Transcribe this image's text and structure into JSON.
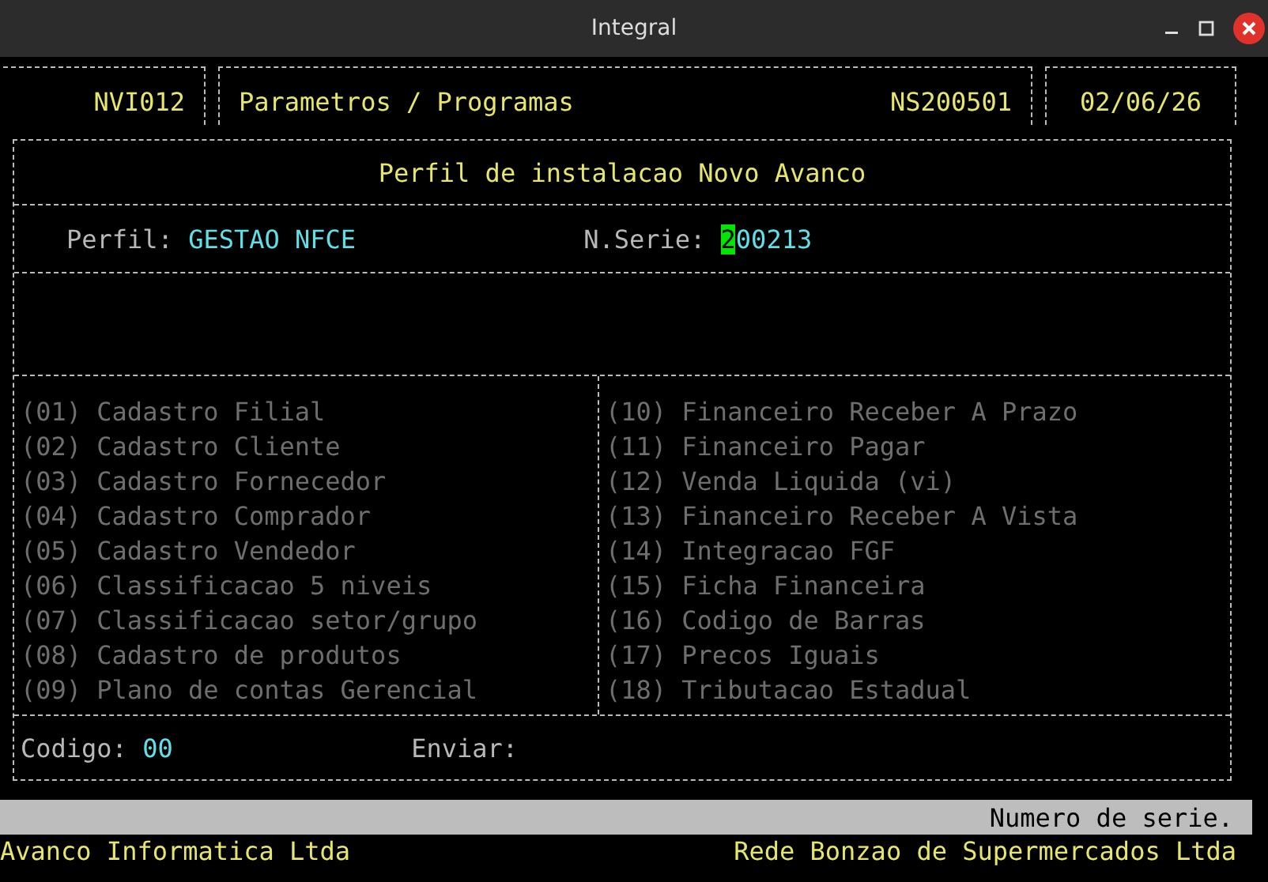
{
  "window": {
    "title": "Integral"
  },
  "header": {
    "program": "NVI012",
    "module": "Parametros / Programas",
    "code": "NS200501",
    "date": "02/06/26"
  },
  "form": {
    "title": "Perfil de instalacao Novo Avanco",
    "perfil": {
      "label": "Perfil:",
      "value": "GESTAO NFCE"
    },
    "serie": {
      "label": "N.Serie:",
      "cursor_char": "2",
      "value_rest": "00213"
    },
    "options_left": [
      {
        "label": "(01) Cadastro Filial",
        "disabled": true
      },
      {
        "label": "(02) Cadastro Cliente",
        "disabled": true
      },
      {
        "label": "(03) Cadastro Fornecedor",
        "disabled": true
      },
      {
        "label": "(04) Cadastro Comprador",
        "disabled": true
      },
      {
        "label": "(05) Cadastro Vendedor",
        "disabled": true
      },
      {
        "label": "(06) Classificacao 5 niveis",
        "disabled": true
      },
      {
        "label": "(07) Classificacao setor/grupo",
        "disabled": true
      },
      {
        "label": "(08) Cadastro de produtos",
        "disabled": true
      },
      {
        "label": "(09) Plano de contas Gerencial",
        "disabled": true
      }
    ],
    "options_right": [
      {
        "label": "(10) Financeiro Receber A Prazo",
        "disabled": true
      },
      {
        "label": "(11) Financeiro Pagar",
        "disabled": true
      },
      {
        "label": "(12) Venda Liquida (vi)",
        "disabled": true
      },
      {
        "label": "(13) Financeiro Receber A Vista",
        "disabled": true
      },
      {
        "label": "(14) Integracao FGF",
        "disabled": true
      },
      {
        "label": "(15) Ficha Financeira",
        "disabled": true
      },
      {
        "label": "(16) Codigo de Barras",
        "disabled": true
      },
      {
        "label": "(17) Precos Iguais",
        "disabled": true
      },
      {
        "label": "(18) Tributacao Estadual",
        "disabled": true
      }
    ],
    "codigo": {
      "label": "Codigo:",
      "value": "00"
    },
    "enviar": {
      "label": "Enviar:"
    }
  },
  "status_bar": {
    "message": "Numero de serie."
  },
  "footer": {
    "left": "Avanco Informatica Ltda",
    "right": "Rede Bonzao de Supermercados Ltda"
  }
}
